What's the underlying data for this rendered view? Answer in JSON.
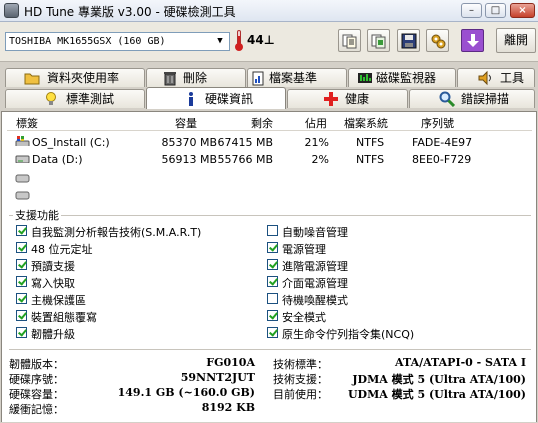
{
  "window": {
    "title": "HD Tune 專業版 v3.00 - 硬碟檢測工具"
  },
  "toolbar": {
    "drive": "TOSHIBA MK1655GSX (160 GB)",
    "temperature": "44⊥",
    "exit_label": "離開",
    "buttons": [
      "copy-text-icon",
      "copy-image-icon",
      "save-icon",
      "options-icon",
      "download-icon"
    ]
  },
  "tabs_top": [
    {
      "label": "資料夾使用率",
      "icon": "folder-icon"
    },
    {
      "label": "刪除",
      "icon": "trash-icon"
    },
    {
      "label": "檔案基準",
      "icon": "file-benchmark-icon"
    },
    {
      "label": "磁碟監視器",
      "icon": "disk-monitor-icon"
    },
    {
      "label": "工具",
      "icon": "speaker-icon"
    }
  ],
  "tabs_bottom": [
    {
      "label": "標準測試",
      "icon": "lightbulb-icon"
    },
    {
      "label": "硬碟資訊",
      "icon": "info-icon",
      "active": true
    },
    {
      "label": "健康",
      "icon": "health-cross-icon"
    },
    {
      "label": "錯誤掃描",
      "icon": "magnifier-icon"
    }
  ],
  "volumes": {
    "headers": [
      "標簽",
      "容量",
      "剩余",
      "佔用",
      "檔案系統",
      "序列號"
    ],
    "rows": [
      {
        "label": "OS_Install (C:)",
        "capacity": "85370 MB",
        "free": "67415 MB",
        "used": "21%",
        "fs": "NTFS",
        "serial": "FADE-4E97"
      },
      {
        "label": "Data (D:)",
        "capacity": "56913 MB",
        "free": "55766 MB",
        "used": "2%",
        "fs": "NTFS",
        "serial": "8EE0-F729"
      }
    ]
  },
  "features": {
    "title": "支援功能",
    "left": [
      {
        "label": "自我監測分析報告技術(S.M.A.R.T)",
        "checked": true
      },
      {
        "label": "48 位元定址",
        "checked": true
      },
      {
        "label": "預讀支援",
        "checked": true
      },
      {
        "label": "寫入快取",
        "checked": true
      },
      {
        "label": "主機保護區",
        "checked": true
      },
      {
        "label": "裝置組態覆寫",
        "checked": true
      },
      {
        "label": "韌體升級",
        "checked": true
      }
    ],
    "right": [
      {
        "label": "自動噪音管理",
        "checked": false
      },
      {
        "label": "電源管理",
        "checked": true
      },
      {
        "label": "進階電源管理",
        "checked": true
      },
      {
        "label": "介面電源管理",
        "checked": true
      },
      {
        "label": "待機喚醒模式",
        "checked": false
      },
      {
        "label": "安全模式",
        "checked": true
      },
      {
        "label": "原生命令佇列指令集(NCQ)",
        "checked": true
      }
    ]
  },
  "details": {
    "firmware_label": "韌體版本：",
    "firmware": "FG010A",
    "serial_label": "硬碟序號：",
    "serial": "59NNT2JUT",
    "capacity_label": "硬碟容量：",
    "capacity": "149.1 GB (~160.0 GB)",
    "buffer_label": "緩衝記憶：",
    "buffer": "8192 KB",
    "standard_label": "技術標準：",
    "standard": "ATA/ATAPI-0 - SATA I",
    "support_label": "技術支援：",
    "support": "JDMA 模式 5 (Ultra ATA/100)",
    "current_label": "目前使用：",
    "current": "UDMA 模式 5 (Ultra ATA/100)"
  }
}
